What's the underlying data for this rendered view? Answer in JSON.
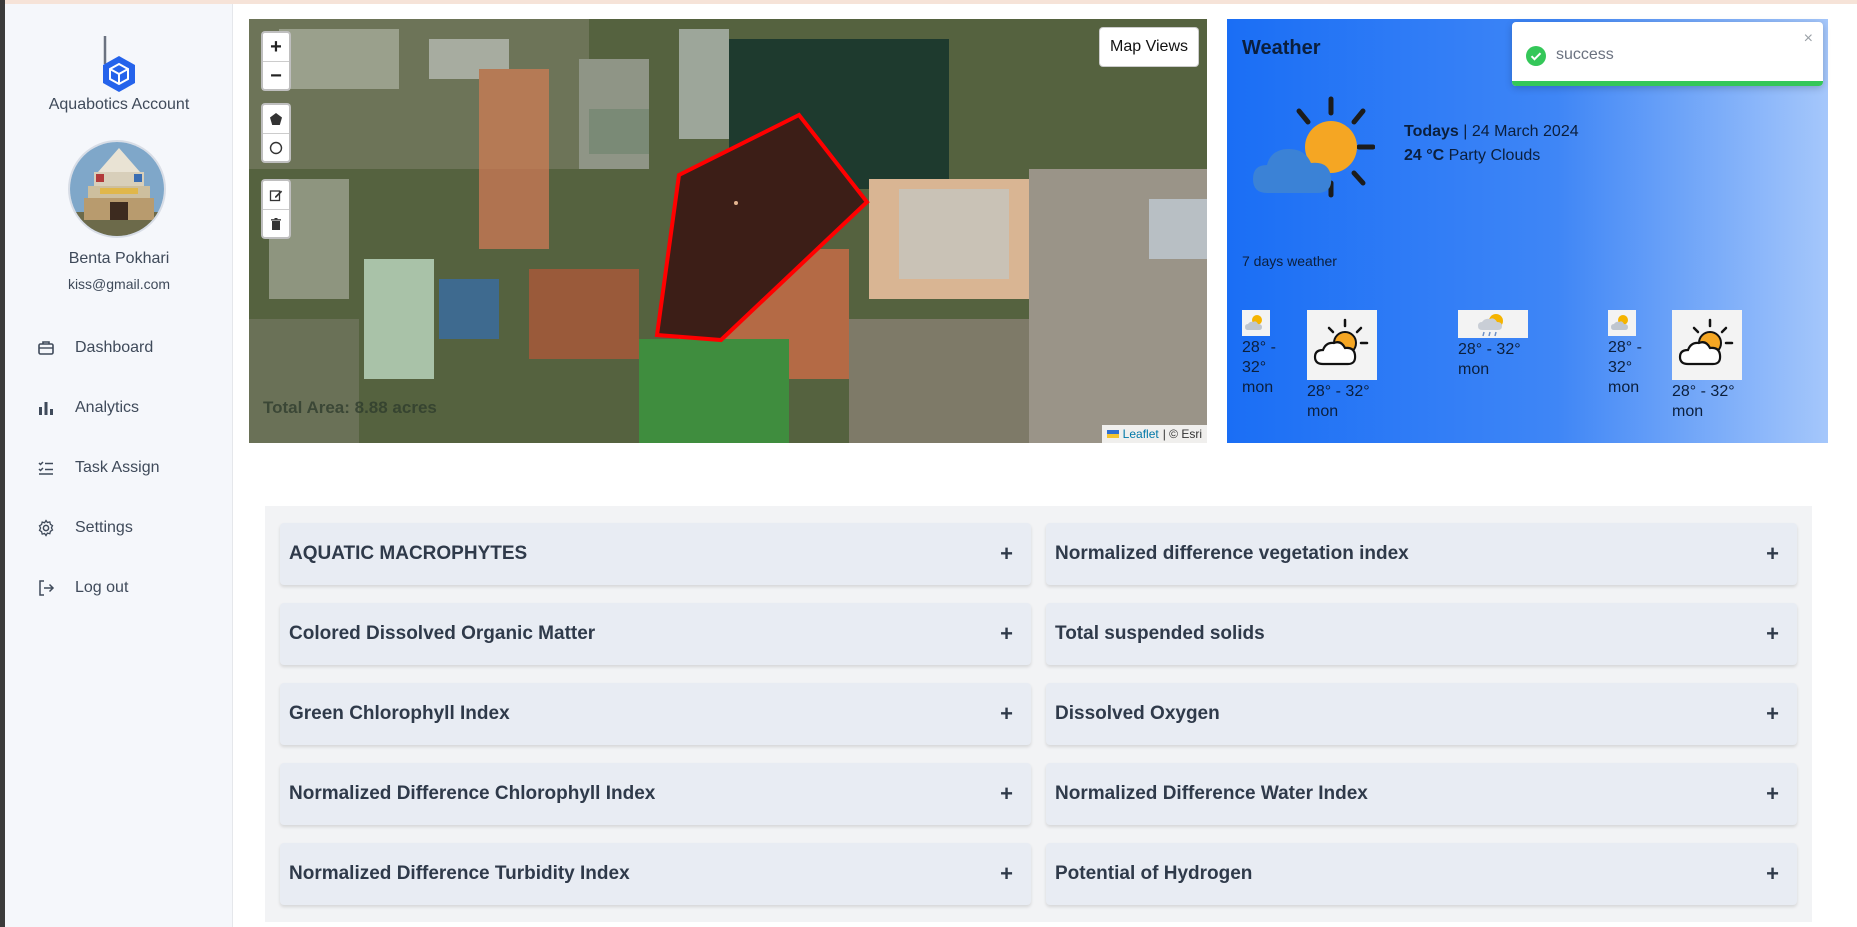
{
  "brand": {
    "name": "Aquabotics Account",
    "logo_icon": "hexagon-cube-icon"
  },
  "user": {
    "name": "Benta Pokhari",
    "email": "kiss@gmail.com"
  },
  "nav": [
    {
      "label": "Dashboard",
      "icon": "briefcase-icon"
    },
    {
      "label": "Analytics",
      "icon": "bar-chart-icon"
    },
    {
      "label": "Task Assign",
      "icon": "checklist-icon"
    },
    {
      "label": "Settings",
      "icon": "gear-icon"
    },
    {
      "label": "Log out",
      "icon": "logout-icon"
    }
  ],
  "map": {
    "zoom_in": "+",
    "zoom_out": "−",
    "views_label": "Map Views",
    "total_area": "Total Area: 8.88 acres",
    "attribution_leaflet": "Leaflet",
    "attribution_rest": "| © Esri",
    "polygon_color": "#ff0000"
  },
  "weather": {
    "title": "Weather",
    "today_label": "Todays",
    "today_date": "| 24 March 2024",
    "today_temp": "24 °C",
    "today_desc": "Party Clouds",
    "days_label": "7 days weather",
    "days": [
      {
        "temp": "28° - 32°",
        "day": "mon",
        "icon": "sun-cloud-small-icon"
      },
      {
        "temp": "28° - 32°",
        "day": "mon",
        "icon": "sun-cloud-icon"
      },
      {
        "temp": "28° - 32°",
        "day": "mon",
        "icon": "sun-rain-icon"
      },
      {
        "temp": "28° - 32°",
        "day": "mon",
        "icon": "sun-cloud-small-icon"
      },
      {
        "temp": "28° - 32°",
        "day": "mon",
        "icon": "sun-cloud-icon"
      }
    ]
  },
  "toast": {
    "message": "success",
    "close": "×",
    "progress": 1.0
  },
  "indices": {
    "left": [
      "AQUATIC MACROPHYTES",
      "Colored Dissolved Organic Matter",
      "Green Chlorophyll Index",
      "Normalized Difference Chlorophyll Index",
      "Normalized Difference Turbidity Index"
    ],
    "right": [
      "Normalized difference vegetation index",
      "Total suspended solids",
      "Dissolved Oxygen",
      "Normalized Difference Water Index",
      "Potential of Hydrogen"
    ],
    "expand_symbol": "+"
  },
  "colors": {
    "accent": "#1a6ef5",
    "success": "#34c759",
    "sidebar_bg": "#f5f7fb"
  }
}
